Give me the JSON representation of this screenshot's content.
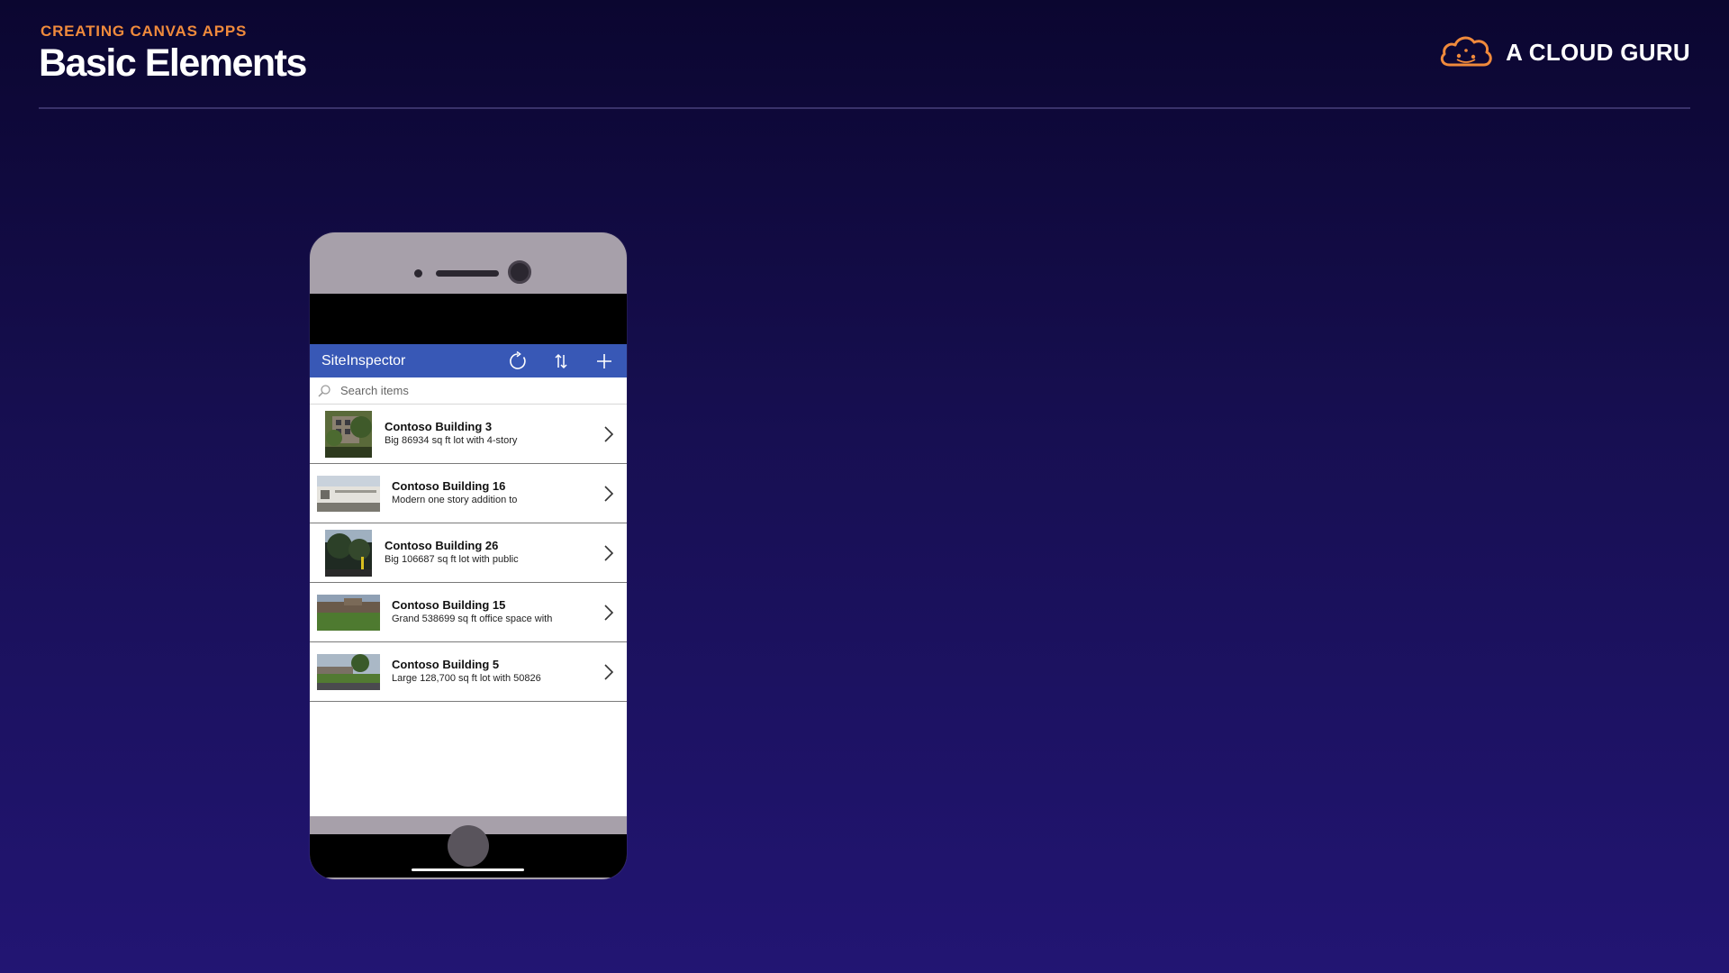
{
  "slide": {
    "eyebrow": "CREATING CANVAS APPS",
    "title": "Basic Elements",
    "brand": "A CLOUD GURU"
  },
  "colors": {
    "accent_orange": "#f08a3c",
    "appbar_blue": "#3858b6",
    "background_top": "#0b0630",
    "background_bottom": "#221573"
  },
  "app": {
    "title": "SiteInspector",
    "icons": [
      "refresh-icon",
      "sort-icon",
      "add-icon"
    ],
    "search": {
      "placeholder": "Search items",
      "value": ""
    },
    "items": [
      {
        "title": "Contoso Building 3",
        "subtitle": "Big 86934 sq ft lot with 4-story"
      },
      {
        "title": "Contoso Building 16",
        "subtitle": "Modern one story addition to"
      },
      {
        "title": "Contoso Building 26",
        "subtitle": "Big 106687 sq ft lot with public"
      },
      {
        "title": "Contoso Building 15",
        "subtitle": "Grand 538699 sq ft office space with"
      },
      {
        "title": "Contoso Building 5",
        "subtitle": "Large 128,700 sq ft lot with 50826"
      }
    ]
  }
}
